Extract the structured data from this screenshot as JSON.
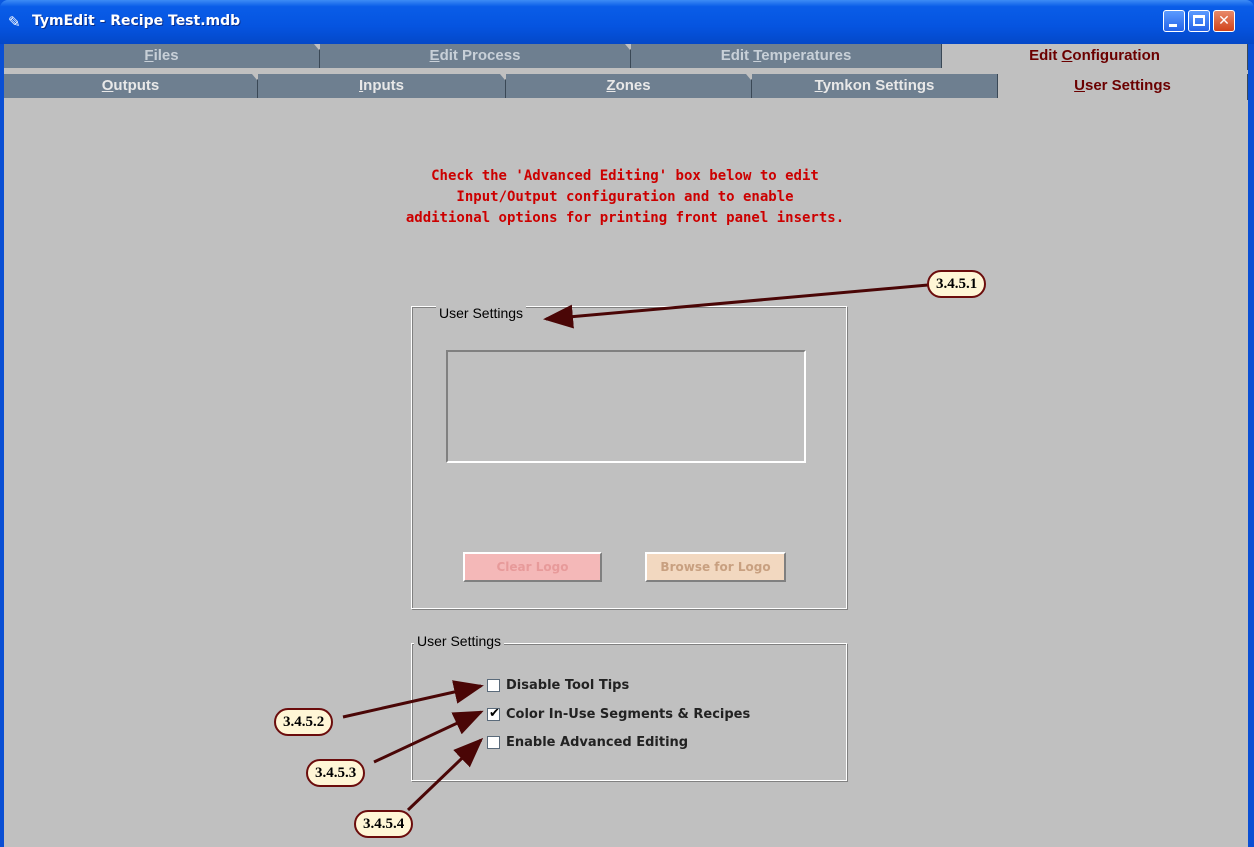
{
  "window": {
    "title": "TymEdit - Recipe Test.mdb"
  },
  "tabs_top": [
    {
      "pre": "",
      "u": "F",
      "post": "iles"
    },
    {
      "pre": "",
      "u": "E",
      "post": "dit Process"
    },
    {
      "pre": "Edit ",
      "u": "T",
      "post": "emperatures"
    },
    {
      "pre": "Edit ",
      "u": "C",
      "post": "onfiguration"
    }
  ],
  "tabs_bottom": [
    {
      "pre": "",
      "u": "O",
      "post": "utputs"
    },
    {
      "pre": "",
      "u": "I",
      "post": "nputs"
    },
    {
      "pre": "",
      "u": "Z",
      "post": "ones"
    },
    {
      "pre": "",
      "u": "T",
      "post": "ymkon Settings"
    },
    {
      "pre": "",
      "u": "U",
      "post": "ser Settings"
    }
  ],
  "instruction": "Check the 'Advanced Editing' box below to edit\nInput/Output configuration and to enable\nadditional options for printing front panel inserts.",
  "logo_group": {
    "legend": "User Settings",
    "clear_button": "Clear Logo",
    "browse_button": "Browse for Logo"
  },
  "options_group": {
    "legend": "User Settings",
    "options": [
      {
        "label": "Disable Tool Tips",
        "checked": false
      },
      {
        "label": "Color In-Use Segments & Recipes",
        "checked": true
      },
      {
        "label": "Enable Advanced Editing",
        "checked": false
      }
    ]
  },
  "callouts": [
    "3.4.5.1",
    "3.4.5.2",
    "3.4.5.3",
    "3.4.5.4"
  ],
  "colors": {
    "instruction": "#cc0000",
    "active_tab_text": "#6b0000",
    "callout_border": "#6b0c0c",
    "callout_fill": "#fff6d6"
  },
  "icons": {
    "app": "app-icon",
    "minimize": "minimize-icon",
    "maximize": "maximize-icon",
    "close": "close-icon",
    "check": "checkmark-icon"
  }
}
